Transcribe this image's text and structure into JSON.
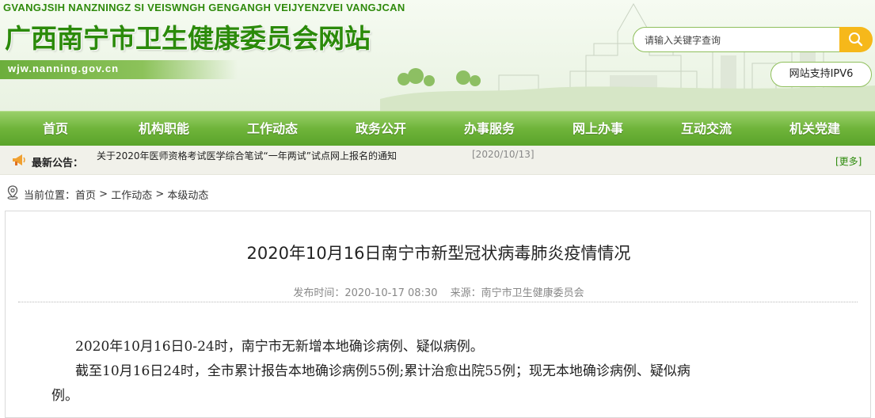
{
  "header": {
    "zhuang_title": "GVANGJSIH NANZNINGZ SI VEISWNGH GENGANGH VEIJYENZVEI VANGJCAN",
    "site_title": "广西南宁市卫生健康委员会网站",
    "domain": "wjw.nanning.gov.cn",
    "search_placeholder": "请输入关键字查询",
    "ipv6_label": "网站支持IPV6"
  },
  "nav": {
    "items": [
      "首页",
      "机构职能",
      "工作动态",
      "政务公开",
      "办事服务",
      "网上办事",
      "互动交流",
      "机关党建"
    ]
  },
  "notice": {
    "label": "最新公告：",
    "text": "关于2020年医师资格考试医学综合笔试“一年两试”试点网上报名的通知",
    "date": "[2020/10/13]",
    "more": "[更多]"
  },
  "breadcrumb": {
    "prefix": "当前位置：",
    "items": [
      "首页",
      "工作动态",
      "本级动态"
    ],
    "separator": ">"
  },
  "article": {
    "title": "2020年10月16日南宁市新型冠状病毒肺炎疫情情况",
    "publish_time": "发布时间：2020-10-17 08:30",
    "source": "来源：南宁市卫生健康委员会",
    "paragraphs": [
      "2020年10月16日0-24时，南宁市无新增本地确诊病例、疑似病例。",
      "截至10月16日24时，全市累计报告本地确诊病例55例;累计治愈出院55例；现无本地确诊病例、疑似病",
      "例。"
    ]
  },
  "colors": {
    "brand_green": "#2b8a0a",
    "nav_green": "#6fb43a",
    "search_button": "#f6b81a"
  }
}
